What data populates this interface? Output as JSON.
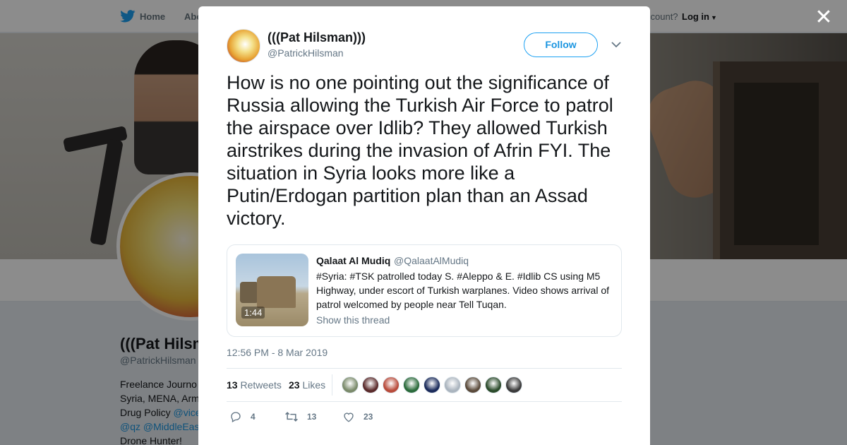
{
  "topnav": {
    "home_label": "Home",
    "about_label": "Abo",
    "account_text": "ccount?",
    "login_label": "Log in"
  },
  "profile": {
    "name": "(((Pat Hilsm",
    "handle": "@PatrickHilsman",
    "bio_lines": [
      "Freelance Journo",
      "Syria, MENA, Arm",
      "Drug Policy",
      "Drone Hunter!"
    ],
    "bio_links": [
      "@vice",
      "@qz",
      "@MiddleEas"
    ]
  },
  "modal": {
    "close_glyph": "✕",
    "author": {
      "name": "(((Pat Hilsman)))",
      "handle": "@PatrickHilsman"
    },
    "follow_label": "Follow",
    "tweet_text": "How is no one pointing out the significance of Russia allowing the Turkish Air Force to patrol the airspace over Idlib? They allowed Turkish airstrikes during the invasion of Afrin FYI. The situation in Syria looks more like a Putin/Erdogan partition plan than an Assad victory.",
    "quote": {
      "name": "Qalaat Al Mudiq",
      "handle": "@QalaatAlMudiq",
      "text": "#Syria: #TSK patrolled today S. #Aleppo & E. #Idlib CS using M5 Highway, under escort of Turkish warplanes. Video shows arrival of patrol welcomed by people near Tell Tuqan.",
      "video_duration": "1:44",
      "show_thread": "Show this thread"
    },
    "timestamp": "12:56 PM - 8 Mar 2019",
    "stats": {
      "retweets_count": "13",
      "retweets_label": "Retweets",
      "likes_count": "23",
      "likes_label": "Likes"
    },
    "liker_colors": [
      "#7a8a6a",
      "#5a2a2a",
      "#b84a3a",
      "#2a6a3a",
      "#1a2a5a",
      "#aab4be",
      "#5a4a3a",
      "#2a4a2a",
      "#3a3a3a"
    ],
    "actions": {
      "reply_count": "4",
      "retweet_count": "13",
      "like_count": "23"
    }
  }
}
